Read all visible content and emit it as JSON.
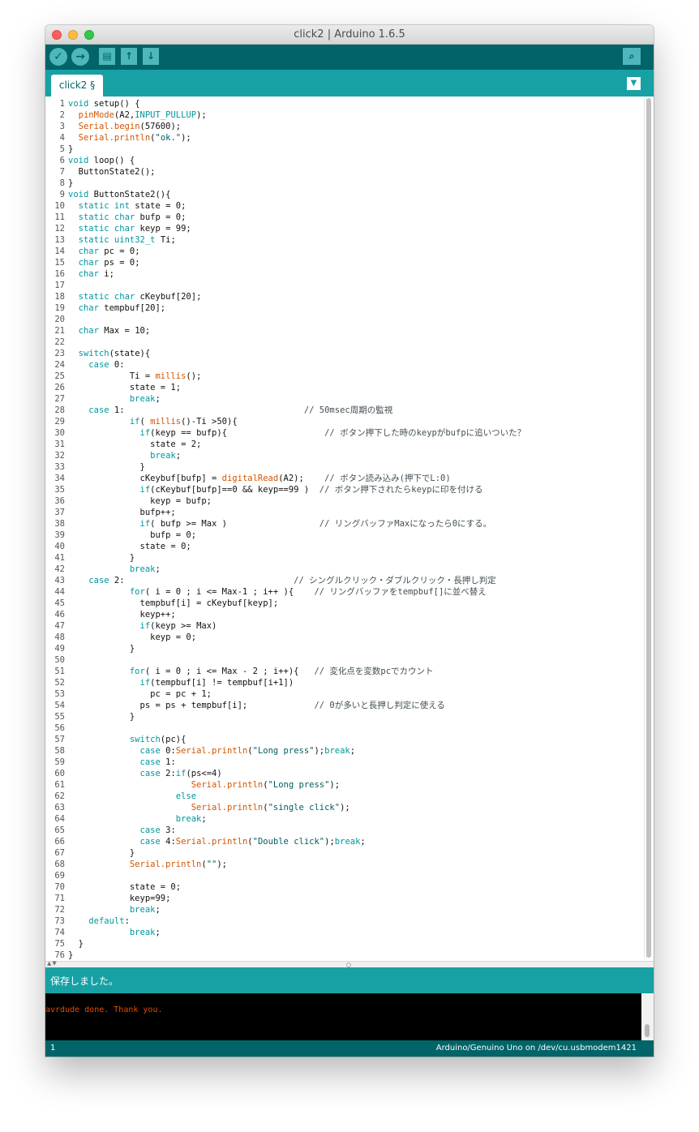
{
  "window": {
    "title": "click2 | Arduino 1.6.5"
  },
  "toolbar": {
    "verify_icon": "✓",
    "upload_icon": "→",
    "new_icon": "▤",
    "open_icon": "↑",
    "save_icon": "↓",
    "serial_monitor_icon": "⌕"
  },
  "tabs": {
    "active_label": "click2 §",
    "menu_icon": "▼"
  },
  "editor": {
    "line_numbers": [
      "1",
      "2",
      "3",
      "4",
      "5",
      "6",
      "7",
      "8",
      "9",
      "10",
      "11",
      "12",
      "13",
      "14",
      "15",
      "16",
      "17",
      "18",
      "19",
      "20",
      "21",
      "22",
      "23",
      "24",
      "25",
      "26",
      "27",
      "28",
      "29",
      "30",
      "31",
      "32",
      "33",
      "34",
      "35",
      "36",
      "37",
      "38",
      "39",
      "40",
      "41",
      "42",
      "43",
      "44",
      "45",
      "46",
      "47",
      "48",
      "49",
      "50",
      "51",
      "52",
      "53",
      "54",
      "55",
      "56",
      "57",
      "58",
      "59",
      "60",
      "61",
      "62",
      "63",
      "64",
      "65",
      "66",
      "67",
      "68",
      "69",
      "70",
      "71",
      "72",
      "73",
      "74",
      "75",
      "76"
    ],
    "lines": [
      "void setup() {",
      "  pinMode(A2,INPUT_PULLUP);",
      "  Serial.begin(57600);",
      "  Serial.println(\"ok.\");",
      "}",
      "void loop() {",
      "  ButtonState2();",
      "}",
      "void ButtonState2(){",
      "  static int state = 0;",
      "  static char bufp = 0;",
      "  static char keyp = 99;",
      "  static uint32_t Ti;",
      "  char pc = 0;",
      "  char ps = 0;",
      "  char i;",
      "",
      "  static char cKeybuf[20];",
      "  char tempbuf[20];",
      "",
      "  char Max = 10;",
      "",
      "  switch(state){",
      "    case 0:",
      "            Ti = millis();",
      "            state = 1;",
      "            break;",
      "    case 1:                                   // 50msec周期の監視",
      "            if( millis()-Ti >50){",
      "              if(keyp == bufp){                   // ボタン押下した時のkeypがbufpに追いついた？",
      "                state = 2;",
      "                break;",
      "              }",
      "              cKeybuf[bufp] = digitalRead(A2);    // ボタン読み込み(押下でL:0)",
      "              if(cKeybuf[bufp]==0 && keyp==99 )  // ボタン押下されたらkeypに印を付ける",
      "                keyp = bufp;",
      "              bufp++;",
      "              if( bufp >= Max )                  // リングバッファMaxになったら0にする。",
      "                bufp = 0;",
      "              state = 0;",
      "            }",
      "            break;",
      "    case 2:                                 // シングルクリック・ダブルクリック・長押し判定",
      "            for( i = 0 ; i <= Max-1 ; i++ ){    // リングバッファをtempbuf[]に並べ替え",
      "              tempbuf[i] = cKeybuf[keyp];",
      "              keyp++;",
      "              if(keyp >= Max)",
      "                keyp = 0;",
      "            }",
      "",
      "            for( i = 0 ; i <= Max - 2 ; i++){   // 変化点を変数pcでカウント",
      "              if(tempbuf[i] != tempbuf[i+1])",
      "                pc = pc + 1;",
      "              ps = ps + tempbuf[i];             // 0が多いと長押し判定に使える",
      "            }",
      "",
      "            switch(pc){",
      "              case 0:Serial.println(\"Long press\");break;",
      "              case 1:",
      "              case 2:if(ps<=4)",
      "                        Serial.println(\"Long press\");",
      "                     else",
      "                        Serial.println(\"single click\");",
      "                     break;",
      "              case 3:",
      "              case 4:Serial.println(\"Double click\");break;",
      "            }",
      "            Serial.println(\"\");",
      "",
      "            state = 0;",
      "            keyp=99;",
      "            break;",
      "    default:",
      "            break;",
      "  }",
      "}"
    ]
  },
  "status": {
    "message": "保存しました。"
  },
  "console": {
    "output": "avrdude done.  Thank you."
  },
  "footer": {
    "line": "1",
    "board": "Arduino/Genuino Uno on /dev/cu.usbmodem1421"
  },
  "colors": {
    "toolbar": "#006468",
    "tabbar": "#17a1a5",
    "keyword": "#00979c",
    "function": "#d35400",
    "console_text": "#e34c00"
  }
}
